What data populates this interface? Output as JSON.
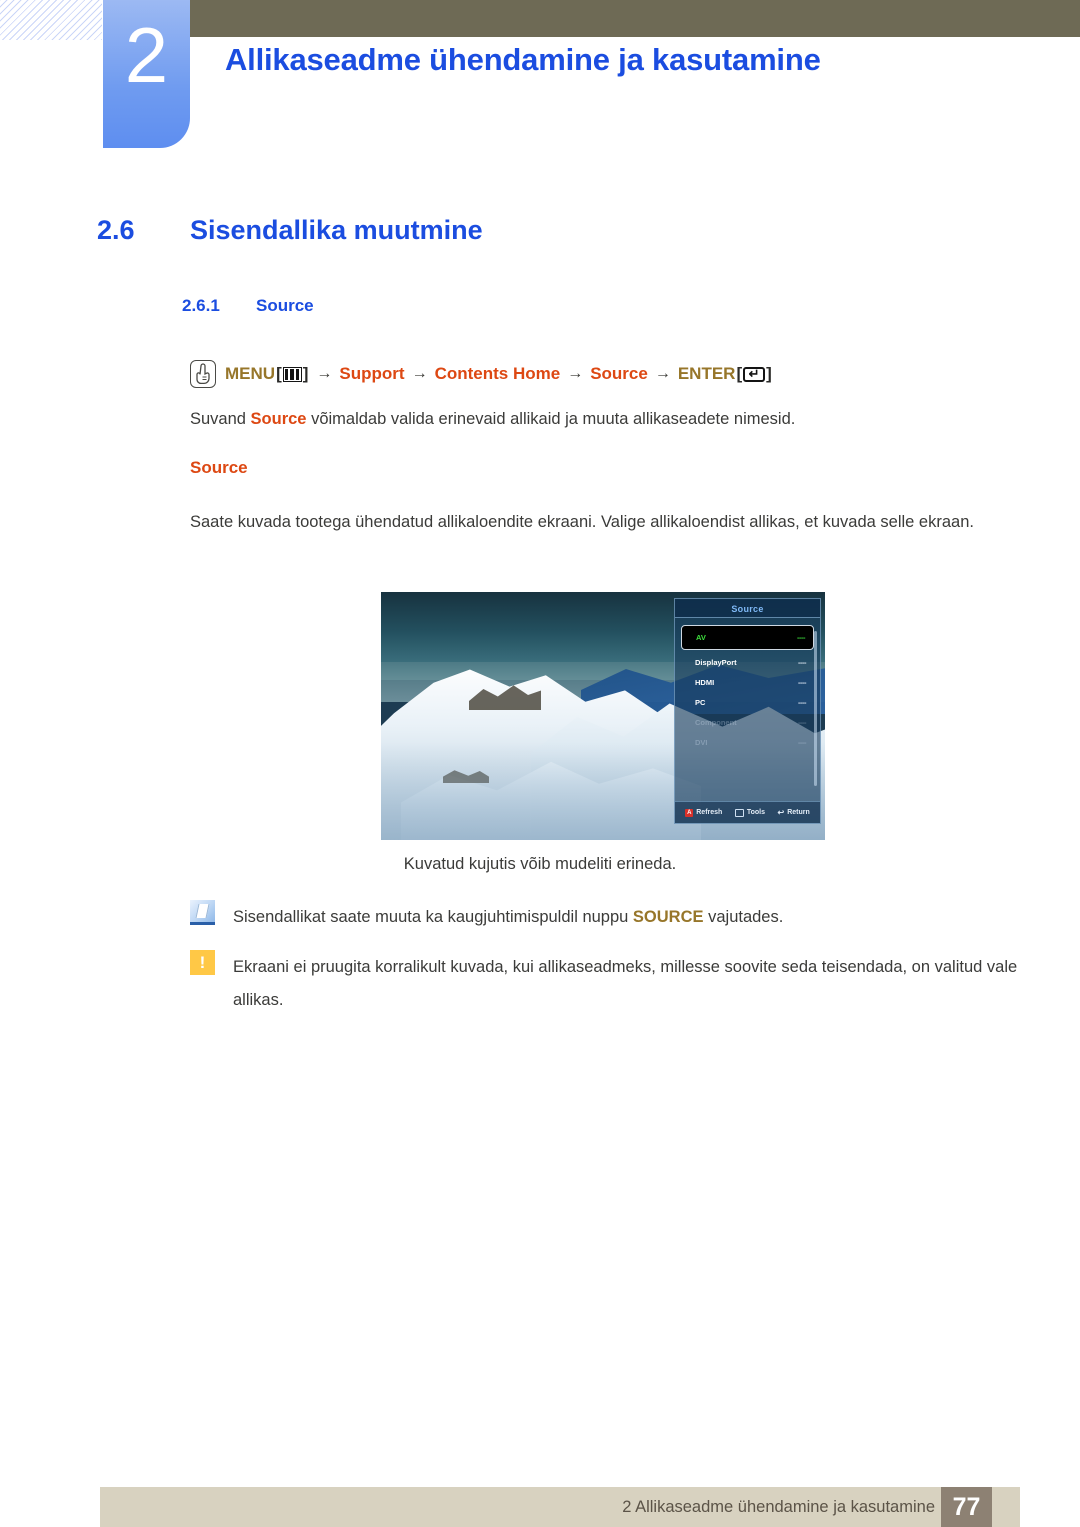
{
  "header": {
    "chapter_number": "2",
    "chapter_title": "Allikaseadme ühendamine ja kasutamine"
  },
  "section": {
    "h2_number": "2.6",
    "h2_title": "Sisendallika muutmine",
    "h3_number": "2.6.1",
    "h3_title": "Source"
  },
  "menu_path": {
    "hand_icon": "hand-press-icon",
    "menu_label": "MENU",
    "menu_key_icon": "menu-bars-icon",
    "bracket_open": "[",
    "bracket_close": "]",
    "arrow": "→",
    "item1": "Support",
    "item2": "Contents Home",
    "item3": "Source",
    "enter_label": "ENTER",
    "enter_key_icon": "enter-return-icon",
    "enter_key_glyph": "↵"
  },
  "intro": {
    "before": "Suvand ",
    "keyword": "Source",
    "after": " võimaldab valida erinevaid allikaid ja muuta allikaseadete nimesid."
  },
  "subheading": "Source",
  "description": "Saate kuvada tootega ühendatud allikaloendite ekraani. Valige allikaloendist allikas, et kuvada selle ekraan.",
  "figure": {
    "caption": "Kuvatud kujutis võib mudeliti erineda.",
    "osd": {
      "title": "Source",
      "rows": [
        {
          "name": "AV",
          "value": "----",
          "state": "selected"
        },
        {
          "name": "DisplayPort",
          "value": "----",
          "state": "normal"
        },
        {
          "name": "HDMI",
          "value": "----",
          "state": "normal"
        },
        {
          "name": "PC",
          "value": "----",
          "state": "normal"
        },
        {
          "name": "Component",
          "value": "----",
          "state": "dim"
        },
        {
          "name": "DVI",
          "value": "----",
          "state": "dim"
        }
      ],
      "footer": [
        {
          "key_icon": "red-key-icon",
          "key_label": "A",
          "label": "Refresh"
        },
        {
          "key_icon": "tools-key-icon",
          "key_label": "",
          "label": "Tools"
        },
        {
          "key_icon": "return-key-icon",
          "key_label": "↩",
          "label": "Return"
        }
      ]
    }
  },
  "notes": [
    {
      "icon": "note-pen-icon",
      "type": "info",
      "before": "Sisendallikat saate muuta ka kaugjuhtimispuldil nuppu ",
      "keyword": "SOURCE",
      "after": " vajutades."
    },
    {
      "icon": "warning-exclamation-icon",
      "type": "warning",
      "glyph": "!",
      "before": "Ekraani ei pruugita korralikult kuvada, kui allikaseadmeks, millesse soovite seda teisendada, on valitud vale allikas.",
      "keyword": "",
      "after": ""
    }
  ],
  "footer": {
    "text": "2 Allikaseadme ühendamine ja kasutamine",
    "page": "77"
  },
  "colors": {
    "heading_blue": "#1b4de0",
    "keyword_orange": "#dd4813",
    "keyword_gold": "#97762a",
    "header_bar": "#6e6a55",
    "footer_bar": "#d8d2c0",
    "page_badge": "#8d8173"
  }
}
